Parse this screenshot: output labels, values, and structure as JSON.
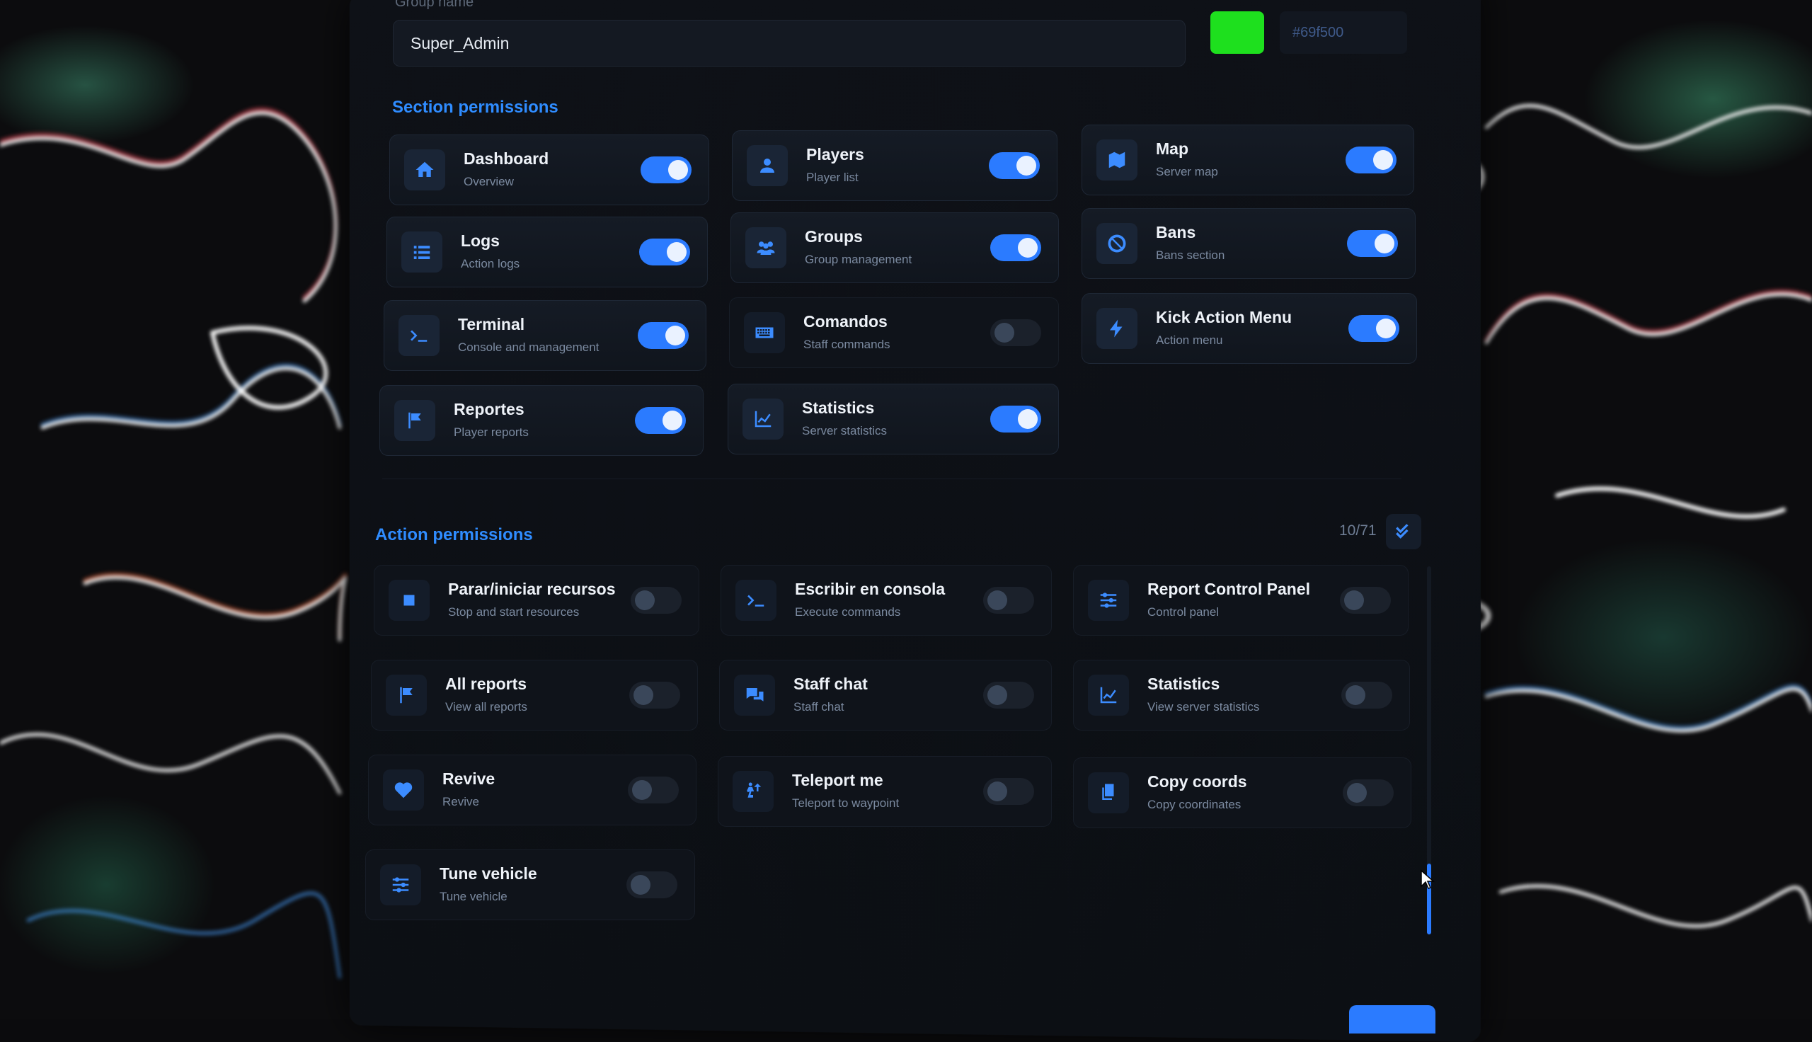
{
  "group": {
    "label": "Group name",
    "name": "Super_Admin",
    "color_hex": "#69f500",
    "color": "#1ee01e"
  },
  "section_permissions": {
    "title": "Section permissions",
    "items": [
      {
        "title": "Dashboard",
        "subtitle": "Overview",
        "icon": "home-icon",
        "enabled": true
      },
      {
        "title": "Players",
        "subtitle": "Player list",
        "icon": "user-icon",
        "enabled": true
      },
      {
        "title": "Map",
        "subtitle": "Server map",
        "icon": "map-icon",
        "enabled": true
      },
      {
        "title": "Logs",
        "subtitle": "Action logs",
        "icon": "list-icon",
        "enabled": true
      },
      {
        "title": "Groups",
        "subtitle": "Group management",
        "icon": "users-icon",
        "enabled": true
      },
      {
        "title": "Bans",
        "subtitle": "Bans section",
        "icon": "ban-icon",
        "enabled": true
      },
      {
        "title": "Terminal",
        "subtitle": "Console and management",
        "icon": "terminal-icon",
        "enabled": true
      },
      {
        "title": "Comandos",
        "subtitle": "Staff commands",
        "icon": "keyboard-icon",
        "enabled": false
      },
      {
        "title": "Kick Action Menu",
        "subtitle": "Action menu",
        "icon": "bolt-icon",
        "enabled": true
      },
      {
        "title": "Reportes",
        "subtitle": "Player reports",
        "icon": "flag-icon",
        "enabled": true
      },
      {
        "title": "Statistics",
        "subtitle": "Server statistics",
        "icon": "chart-icon",
        "enabled": true
      }
    ]
  },
  "action_permissions": {
    "title": "Action permissions",
    "counter": "10/71",
    "items": [
      {
        "title": "Parar/iniciar recursos",
        "subtitle": "Stop and start resources",
        "icon": "stop-icon",
        "enabled": false
      },
      {
        "title": "Escribir en consola",
        "subtitle": "Execute commands",
        "icon": "terminal-icon",
        "enabled": false
      },
      {
        "title": "Report Control Panel",
        "subtitle": "Control panel",
        "icon": "sliders-icon",
        "enabled": false
      },
      {
        "title": "All reports",
        "subtitle": "View all reports",
        "icon": "flag-icon",
        "enabled": false
      },
      {
        "title": "Staff chat",
        "subtitle": "Staff chat",
        "icon": "chat-icon",
        "enabled": false
      },
      {
        "title": "Statistics",
        "subtitle": "View server statistics",
        "icon": "chart-icon",
        "enabled": false
      },
      {
        "title": "Revive",
        "subtitle": "Revive",
        "icon": "heart-pulse-icon",
        "enabled": false
      },
      {
        "title": "Teleport me",
        "subtitle": "Teleport to waypoint",
        "icon": "teleport-icon",
        "enabled": false
      },
      {
        "title": "Copy coords",
        "subtitle": "Copy coordinates",
        "icon": "copy-icon",
        "enabled": false
      },
      {
        "title": "Tune vehicle",
        "subtitle": "Tune vehicle",
        "icon": "sliders-icon",
        "enabled": false
      }
    ]
  }
}
